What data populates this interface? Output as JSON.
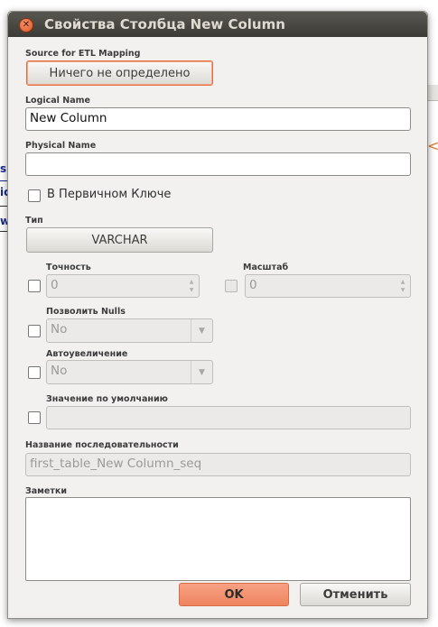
{
  "window": {
    "title": "Свойства Столбца New Column"
  },
  "background_fragments": [
    "s",
    "ic",
    "w",
    "<"
  ],
  "etl": {
    "label": "Source for ETL Mapping",
    "button_label": "Ничего не определено"
  },
  "logical_name": {
    "label": "Logical Name",
    "value": "New Column"
  },
  "physical_name": {
    "label": "Physical Name",
    "value": ""
  },
  "primary_key": {
    "label": "В Первичном Ключе",
    "checked": false
  },
  "type": {
    "label": "Тип",
    "value": "VARCHAR"
  },
  "precision": {
    "label": "Точность",
    "value": "0"
  },
  "scale": {
    "label": "Масштаб",
    "value": "0"
  },
  "nullable": {
    "label": "Позволить Nulls",
    "value": "No"
  },
  "autoincrement": {
    "label": "Автоувеличение",
    "value": "No"
  },
  "default_value": {
    "label": "Значение по умолчанию",
    "value": ""
  },
  "sequence_name": {
    "label": "Название последовательности",
    "value": "first_table_New Column_seq"
  },
  "notes": {
    "label": "Заметки",
    "value": ""
  },
  "buttons": {
    "ok": "OK",
    "cancel": "Отменить"
  },
  "colors": {
    "titlebar": "#3c3b37",
    "accent": "#ee845e",
    "window_bg": "#f2f1f0"
  }
}
